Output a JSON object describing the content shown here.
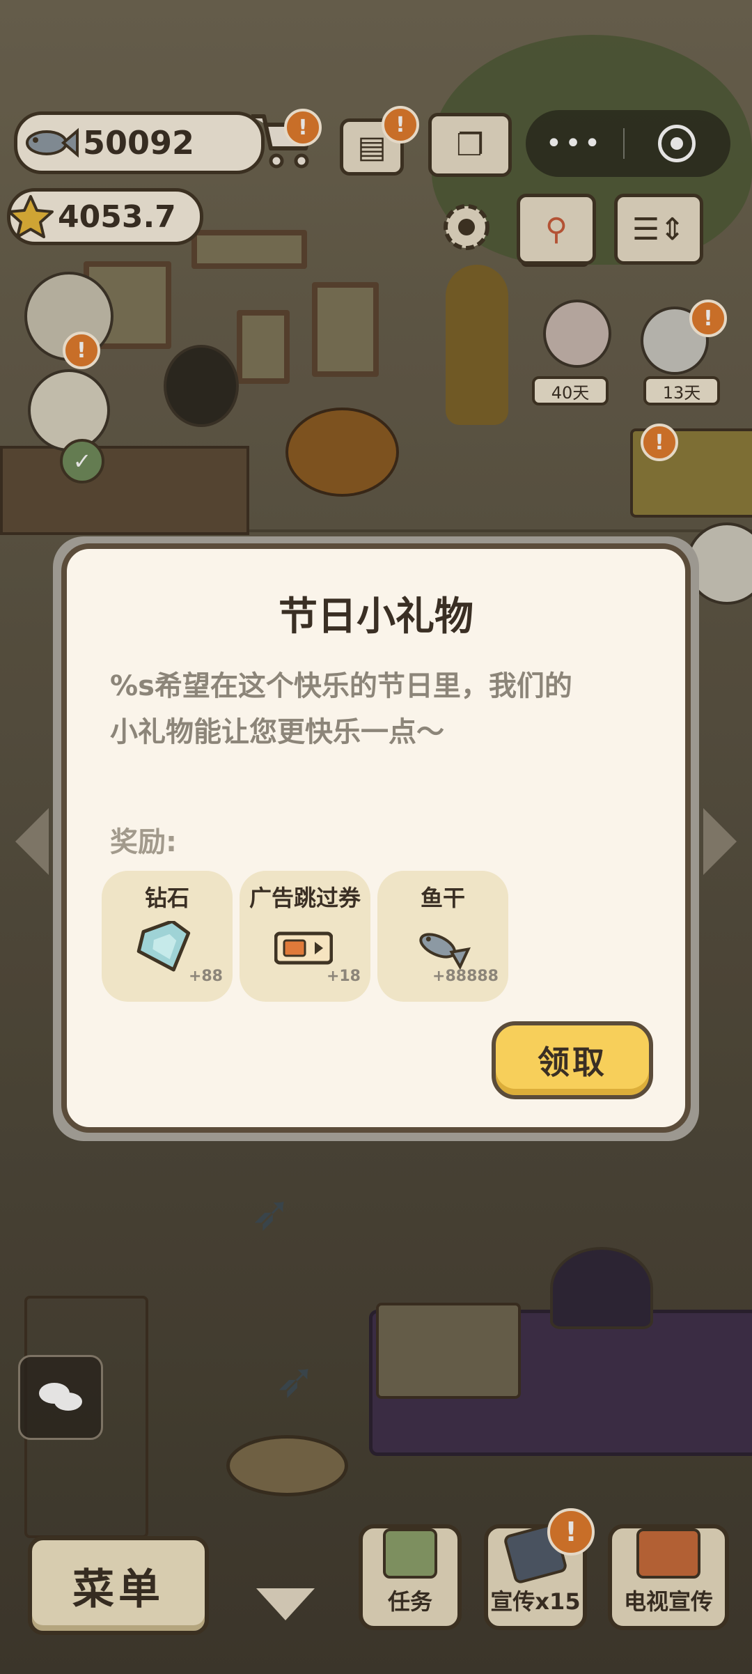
{
  "hud": {
    "fish_count": "50092",
    "star_count": "4053.7",
    "alert_mark": "!"
  },
  "characters": {
    "day_tag_1": "40天",
    "day_tag_2": "13天"
  },
  "modal": {
    "title": "节日小礼物",
    "description_line1": "%s希望在这个快乐的节日里，我们的",
    "description_line2": "小礼物能让您更快乐一点～",
    "reward_label": "奖励:",
    "rewards": [
      {
        "name": "钻石",
        "amount": "+88",
        "icon": "diamond-icon"
      },
      {
        "name": "广告跳过券",
        "amount": "+18",
        "icon": "ad-skip-ticket-icon"
      },
      {
        "name": "鱼干",
        "amount": "+88888",
        "icon": "dried-fish-icon"
      }
    ],
    "claim_label": "领取"
  },
  "bottom_bar": {
    "menu_label": "菜单",
    "task_label": "任务",
    "promote_label": "宣传x15",
    "tv_promote_label": "电视宣传"
  },
  "colors": {
    "accent": "#f7cf5a",
    "alert": "#e07a2c",
    "modal_bg": "#faf4ea",
    "outline": "#5b4c3a"
  }
}
